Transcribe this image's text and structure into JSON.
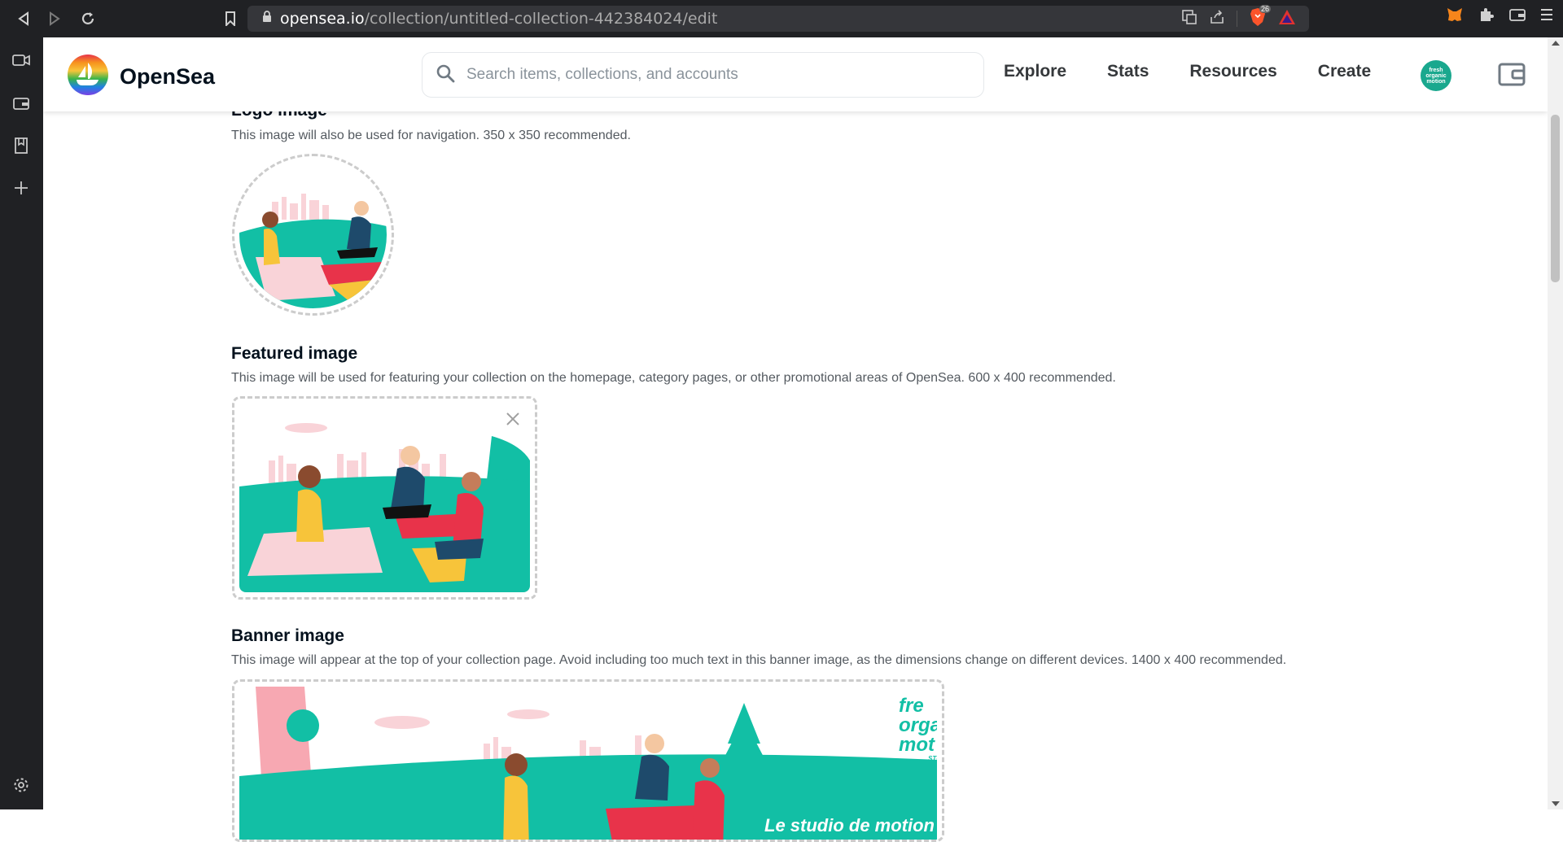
{
  "browser": {
    "url_host": "opensea.io",
    "url_path": "/collection/untitled-collection-442384024/edit",
    "brave_badge": "26"
  },
  "nav": {
    "brand": "OpenSea",
    "search_placeholder": "Search items, collections, and accounts",
    "menu": [
      "Explore",
      "Stats",
      "Resources",
      "Create"
    ]
  },
  "logo_section": {
    "title": "Logo image",
    "description": "This image will also be used for navigation. 350 x 350 recommended."
  },
  "featured_section": {
    "title": "Featured image",
    "description": "This image will be used for featuring your collection on the homepage, category pages, or other promotional areas of OpenSea. 600 x 400 recommended."
  },
  "banner_section": {
    "title": "Banner image",
    "description": "This image will appear at the top of your collection page. Avoid including too much text in this banner image, as the dimensions change on different devices. 1400 x 400 recommended.",
    "banner_text": "Le studio de motion de",
    "banner_logo_lines": [
      "fre",
      "orga",
      "mot",
      "STU"
    ]
  },
  "avatar_text": "fresh organic motion",
  "colors": {
    "accent_teal": "#12bfa5",
    "pink": "#f9d3d8",
    "red": "#e8334a",
    "yellow": "#f7c43a",
    "navy": "#1e4a6b"
  }
}
